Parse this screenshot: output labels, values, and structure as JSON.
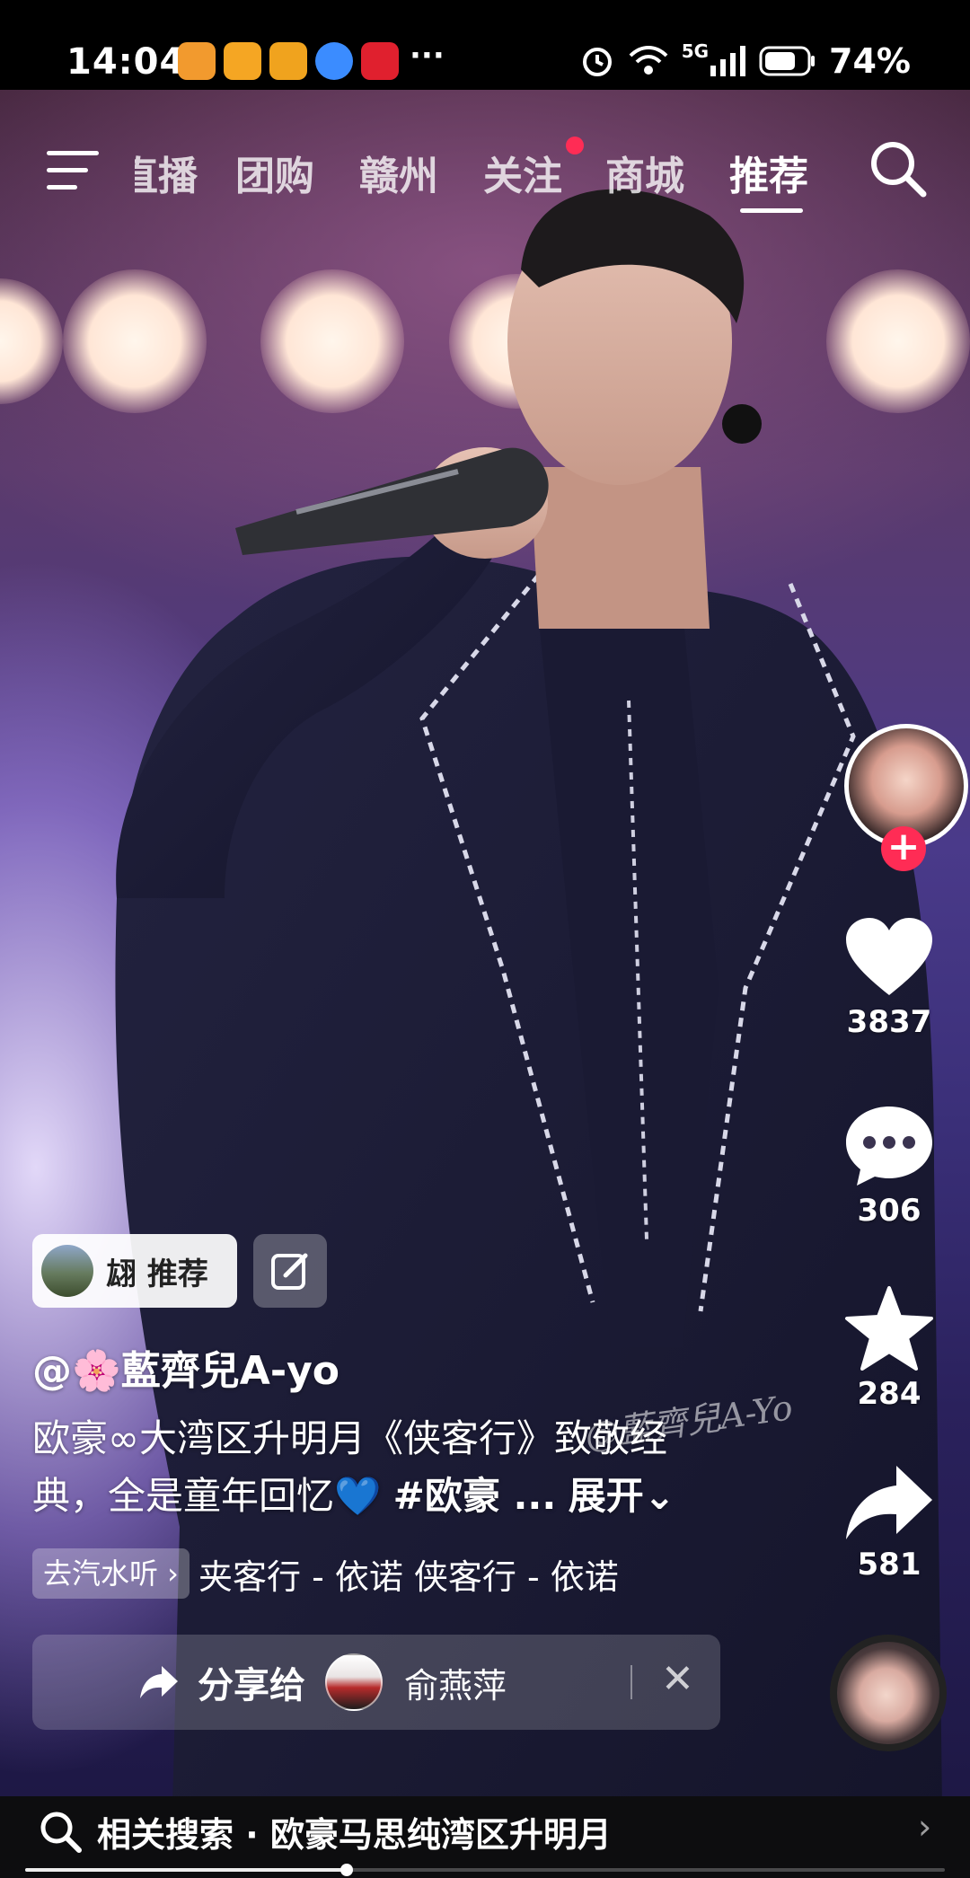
{
  "status_bar": {
    "time": "14:04",
    "network": "5G",
    "battery": "74%",
    "more": "···"
  },
  "top_nav": {
    "tabs": [
      {
        "label": "直播"
      },
      {
        "label": "团购"
      },
      {
        "label": "赣州"
      },
      {
        "label": "关注"
      },
      {
        "label": "商城"
      },
      {
        "label": "推荐"
      }
    ],
    "active_tab": "推荐"
  },
  "rail": {
    "follow": "+",
    "likes": "3837",
    "comments": "306",
    "favorites": "284",
    "shares": "581"
  },
  "post": {
    "recommender": "翃 推荐",
    "author": "@🌸藍齊兒A-yo",
    "description_line1": "欧豪∞大湾区升明月《侠客行》致敬经",
    "description_line2_prefix": "典，全是童年回忆💙 ",
    "hashtag": "#欧豪 ...",
    "expand": "展开⌄",
    "watermark": "@藍齊兒A-Yo"
  },
  "music": {
    "chip": "去汽水听 ›",
    "track": "夹客行 - 依诺    侠客行 - 依诺"
  },
  "share": {
    "label": "分享给",
    "name": "俞燕萍",
    "close": "✕"
  },
  "bottom_bar": {
    "text": "相关搜索 · 欧豪马思纯湾区升明月",
    "chevron": "›"
  },
  "playback": {
    "progress": 0.35
  },
  "colors": {
    "accent": "#ff2c55",
    "stage_purple": "#3a2f78"
  }
}
